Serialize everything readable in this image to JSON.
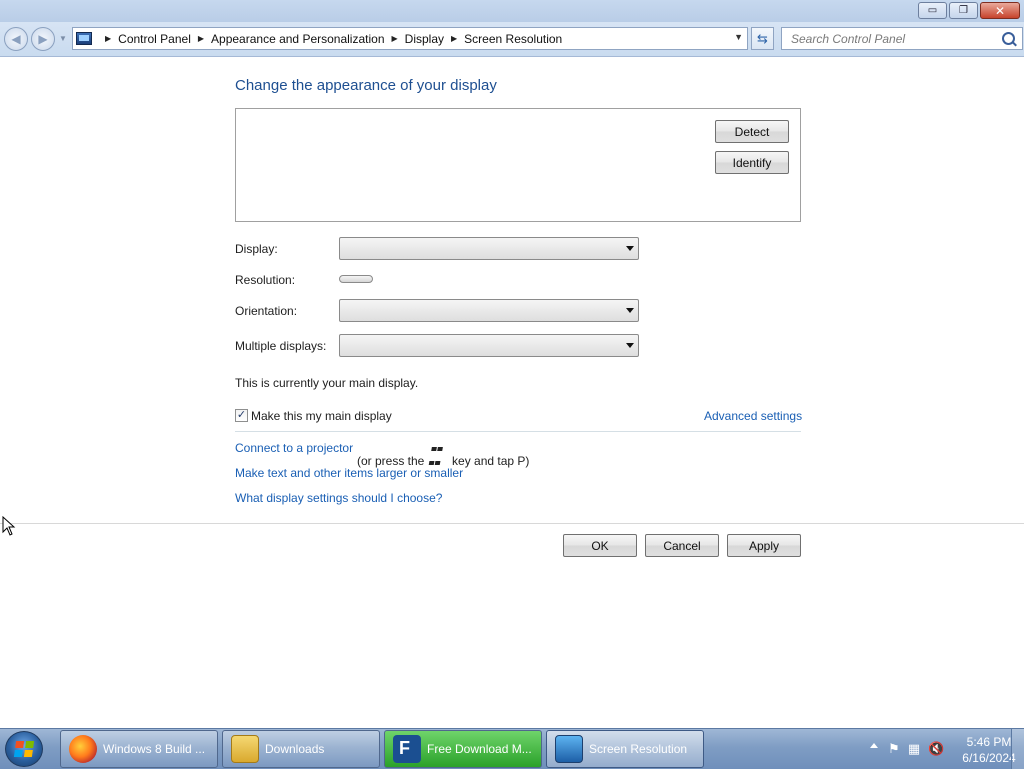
{
  "window": {
    "caption_buttons": {
      "minimize": "▭",
      "restore": "❐",
      "close": "✕"
    }
  },
  "address_bar": {
    "breadcrumbs": [
      "Control Panel",
      "Appearance and Personalization",
      "Display",
      "Screen Resolution"
    ],
    "refresh_icon": "⇆"
  },
  "search": {
    "placeholder": "Search Control Panel",
    "value": ""
  },
  "content": {
    "heading": "Change the appearance of your display",
    "detect_button": "Detect",
    "identify_button": "Identify",
    "display_label": "Display:",
    "display_value": "",
    "resolution_label": "Resolution:",
    "orientation_label": "Orientation:",
    "orientation_value": "",
    "multiple_displays_label": "Multiple displays:",
    "multiple_displays_value": "",
    "main_display_text": "This is currently your main display.",
    "make_main_checkbox_label": "Make this my main display",
    "make_main_checked": true,
    "advanced_settings_link": "Advanced settings",
    "projector_link": "Connect to a projector",
    "projector_hint_prefix": "(or press the",
    "projector_hint_suffix": "key and tap P)",
    "text_size_link": "Make text and other items larger or smaller",
    "help_link": "What display settings should I choose?"
  },
  "dialog_buttons": {
    "ok": "OK",
    "cancel": "Cancel",
    "apply": "Apply"
  },
  "taskbar": {
    "items": [
      {
        "label": "Windows 8 Build ...",
        "icon": "firefox-icon"
      },
      {
        "label": "Downloads",
        "icon": "folder-icon"
      },
      {
        "label": "Free Download M...",
        "icon": "fdm-icon"
      },
      {
        "label": "Screen Resolution",
        "icon": "display-icon"
      }
    ],
    "clock_time": "5:46 PM",
    "clock_date": "6/16/2024"
  },
  "colors": {
    "link": "#1a5fb4",
    "heading": "#1e4f91"
  }
}
